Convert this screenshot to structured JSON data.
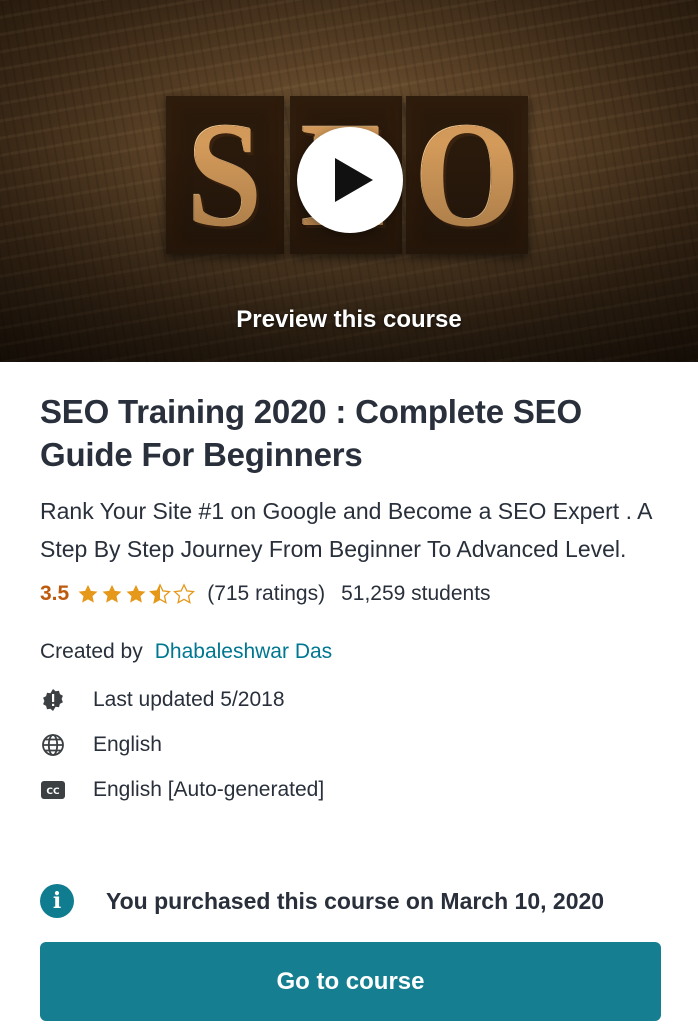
{
  "hero": {
    "letters": [
      "S",
      "E",
      "O"
    ],
    "preview_label": "Preview this course"
  },
  "course": {
    "title": "SEO Training 2020 : Complete SEO Guide For Beginners",
    "subtitle": "Rank Your Site #1 on Google and Become a SEO Expert . A Step By Step Journey From Beginner To Advanced Level.",
    "rating": {
      "value": "3.5",
      "stars": 3.5,
      "count_text": "(715 ratings)",
      "students_text": "51,259 students"
    },
    "created_label": "Created by",
    "author": "Dhabaleshwar Das",
    "meta": [
      {
        "icon": "alert-badge-icon",
        "text": "Last updated 5/2018"
      },
      {
        "icon": "globe-icon",
        "text": "English"
      },
      {
        "icon": "closed-captions-icon",
        "text": "English [Auto-generated]"
      }
    ]
  },
  "purchase": {
    "icon": "info-icon",
    "text": "You purchased this course on March 10, 2020"
  },
  "actions": {
    "go_to_course_label": "Go to course"
  },
  "colors": {
    "accent": "#157f91",
    "link": "#007791",
    "rating": "#be5a0e",
    "star": "#e59819",
    "text": "#29303b"
  }
}
